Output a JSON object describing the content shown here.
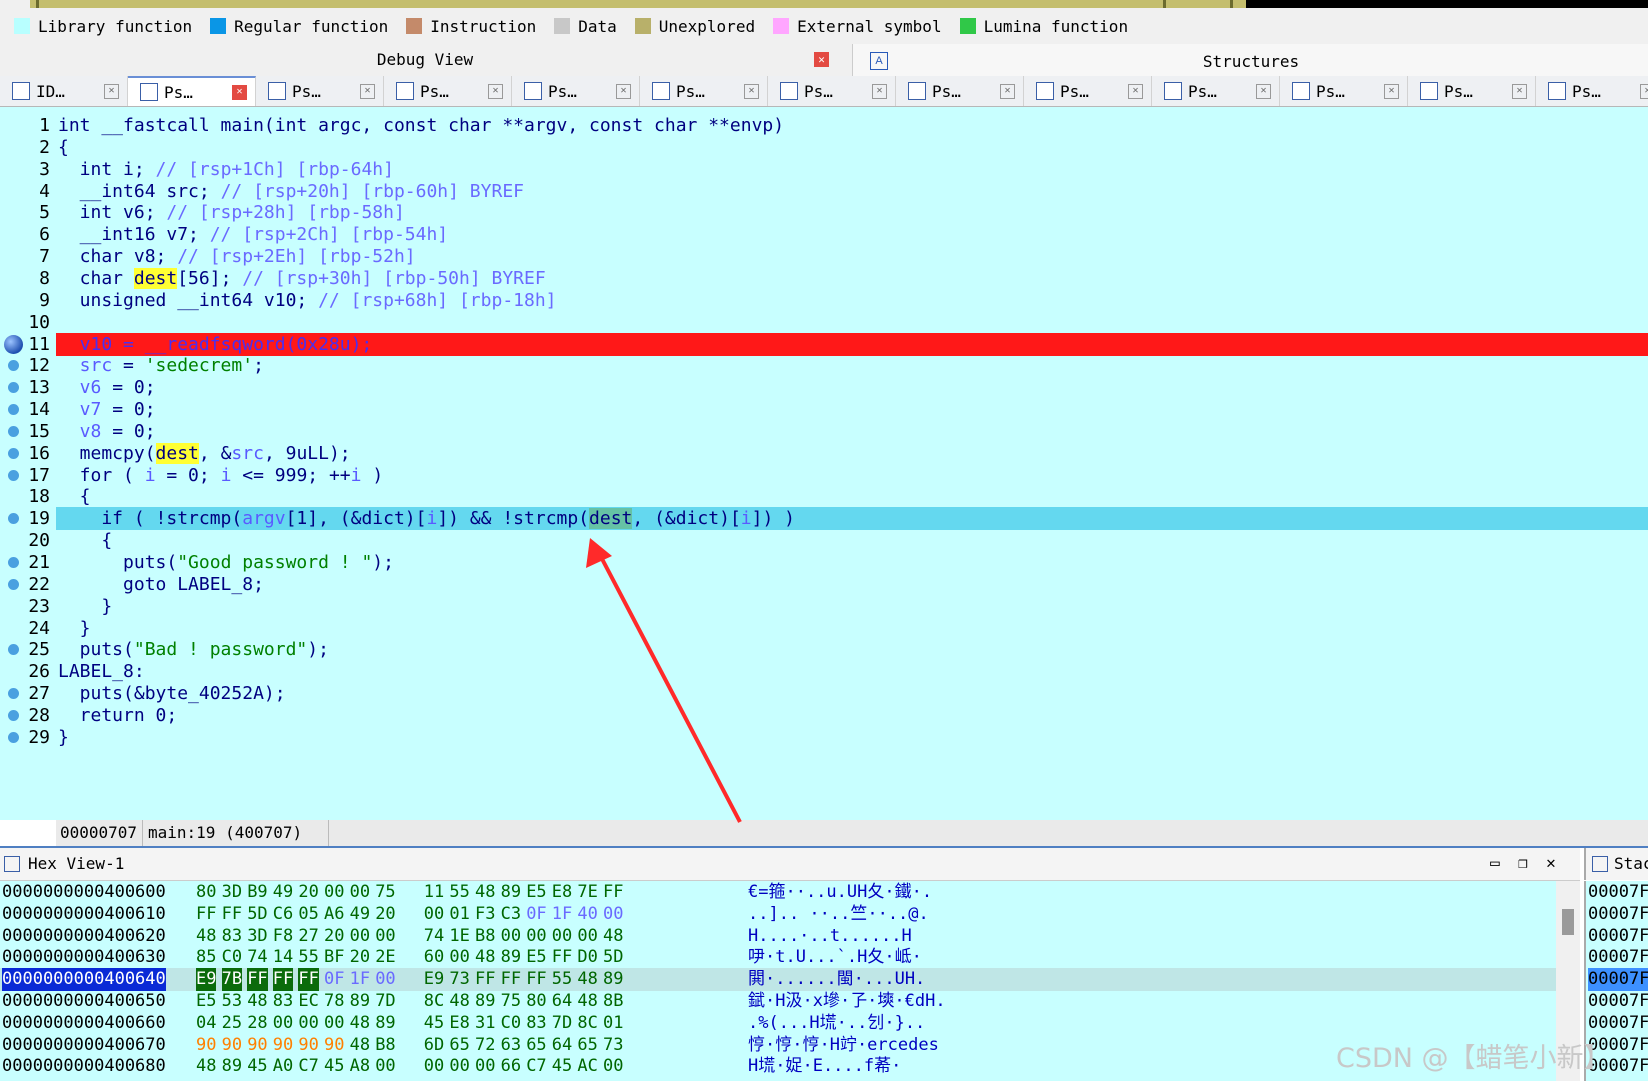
{
  "legend": [
    {
      "label": "Library function",
      "color": "#b8ffff"
    },
    {
      "label": "Regular function",
      "color": "#0a96e6"
    },
    {
      "label": "Instruction",
      "color": "#c48a6a"
    },
    {
      "label": "Data",
      "color": "#c8c8c8"
    },
    {
      "label": "Unexplored",
      "color": "#b8b06a"
    },
    {
      "label": "External symbol",
      "color": "#ffa6ff"
    },
    {
      "label": "Lumina function",
      "color": "#30c848"
    }
  ],
  "views": {
    "debug_title": "Debug View",
    "structures_title": "Structures"
  },
  "tabs": [
    {
      "label": "ID…",
      "active": false
    },
    {
      "label": "Ps…",
      "active": true
    },
    {
      "label": "Ps…",
      "active": false
    },
    {
      "label": "Ps…",
      "active": false
    },
    {
      "label": "Ps…",
      "active": false
    },
    {
      "label": "Ps…",
      "active": false
    },
    {
      "label": "Ps…",
      "active": false
    },
    {
      "label": "Ps…",
      "active": false
    },
    {
      "label": "Ps…",
      "active": false
    },
    {
      "label": "Ps…",
      "active": false
    },
    {
      "label": "Ps…",
      "active": false
    },
    {
      "label": "Ps…",
      "active": false
    },
    {
      "label": "Ps…",
      "active": false
    }
  ],
  "code_lines": [
    {
      "n": "1",
      "bp": "",
      "hl": "",
      "segs": [
        [
          "k",
          "int __fastcall main(int argc, const char **argv, const char **envp)"
        ]
      ]
    },
    {
      "n": "2",
      "bp": "",
      "hl": "",
      "segs": [
        [
          "k",
          "{"
        ]
      ]
    },
    {
      "n": "3",
      "bp": "",
      "hl": "",
      "segs": [
        [
          "k",
          "  int i; "
        ],
        [
          "c",
          "// [rsp+1Ch] [rbp-64h]"
        ]
      ]
    },
    {
      "n": "4",
      "bp": "",
      "hl": "",
      "segs": [
        [
          "k",
          "  __int64 src; "
        ],
        [
          "c",
          "// [rsp+20h] [rbp-60h] BYREF"
        ]
      ]
    },
    {
      "n": "5",
      "bp": "",
      "hl": "",
      "segs": [
        [
          "k",
          "  int v6; "
        ],
        [
          "c",
          "// [rsp+28h] [rbp-58h]"
        ]
      ]
    },
    {
      "n": "6",
      "bp": "",
      "hl": "",
      "segs": [
        [
          "k",
          "  __int16 v7; "
        ],
        [
          "c",
          "// [rsp+2Ch] [rbp-54h]"
        ]
      ]
    },
    {
      "n": "7",
      "bp": "",
      "hl": "",
      "segs": [
        [
          "k",
          "  char v8; "
        ],
        [
          "c",
          "// [rsp+2Eh] [rbp-52h]"
        ]
      ]
    },
    {
      "n": "8",
      "bp": "",
      "hl": "",
      "segs": [
        [
          "k",
          "  char "
        ],
        [
          "yl",
          "dest"
        ],
        [
          "k",
          "[56]; "
        ],
        [
          "c",
          "// [rsp+30h] [rbp-50h] BYREF"
        ]
      ]
    },
    {
      "n": "9",
      "bp": "",
      "hl": "",
      "segs": [
        [
          "k",
          "  unsigned __int64 v10; "
        ],
        [
          "c",
          "// [rsp+68h] [rbp-18h]"
        ]
      ]
    },
    {
      "n": "10",
      "bp": "",
      "hl": "",
      "segs": []
    },
    {
      "n": "11",
      "bp": "big",
      "hl": "red",
      "segs": [
        [
          "redtxt",
          "  v10 = __readfsqword(0x28u);"
        ]
      ]
    },
    {
      "n": "12",
      "bp": "dot",
      "hl": "",
      "segs": [
        [
          "v",
          "  src"
        ],
        [
          "k",
          " = "
        ],
        [
          "s",
          "'sedecrem'"
        ],
        [
          "k",
          ";"
        ]
      ]
    },
    {
      "n": "13",
      "bp": "dot",
      "hl": "",
      "segs": [
        [
          "v",
          "  v6"
        ],
        [
          "k",
          " = 0;"
        ]
      ]
    },
    {
      "n": "14",
      "bp": "dot",
      "hl": "",
      "segs": [
        [
          "v",
          "  v7"
        ],
        [
          "k",
          " = 0;"
        ]
      ]
    },
    {
      "n": "15",
      "bp": "dot",
      "hl": "",
      "segs": [
        [
          "v",
          "  v8"
        ],
        [
          "k",
          " = 0;"
        ]
      ]
    },
    {
      "n": "16",
      "bp": "dot",
      "hl": "",
      "segs": [
        [
          "k",
          "  memcpy("
        ],
        [
          "yl",
          "dest"
        ],
        [
          "k",
          ", &"
        ],
        [
          "v",
          "src"
        ],
        [
          "k",
          ", 9uLL);"
        ]
      ]
    },
    {
      "n": "17",
      "bp": "dot",
      "hl": "",
      "segs": [
        [
          "k",
          "  for ( "
        ],
        [
          "v",
          "i"
        ],
        [
          "k",
          " = 0; "
        ],
        [
          "v",
          "i"
        ],
        [
          "k",
          " <= 999; ++"
        ],
        [
          "v",
          "i"
        ],
        [
          "k",
          " )"
        ]
      ]
    },
    {
      "n": "18",
      "bp": "",
      "hl": "",
      "segs": [
        [
          "k",
          "  {"
        ]
      ]
    },
    {
      "n": "19",
      "bp": "dot",
      "hl": "blue",
      "segs": [
        [
          "k",
          "    if ( !strcmp("
        ],
        [
          "v",
          "argv"
        ],
        [
          "k",
          "[1], (&dict)["
        ],
        [
          "v",
          "i"
        ],
        [
          "k",
          "]) && !strcmp("
        ],
        [
          "gn",
          "dest"
        ],
        [
          "k",
          ", (&dict)["
        ],
        [
          "v",
          "i"
        ],
        [
          "k",
          "]) )"
        ]
      ]
    },
    {
      "n": "20",
      "bp": "",
      "hl": "",
      "segs": [
        [
          "k",
          "    {"
        ]
      ]
    },
    {
      "n": "21",
      "bp": "dot",
      "hl": "",
      "segs": [
        [
          "k",
          "      puts("
        ],
        [
          "s",
          "\"Good password ! \""
        ],
        [
          "k",
          ");"
        ]
      ]
    },
    {
      "n": "22",
      "bp": "dot",
      "hl": "",
      "segs": [
        [
          "k",
          "      goto LABEL_8;"
        ]
      ]
    },
    {
      "n": "23",
      "bp": "",
      "hl": "",
      "segs": [
        [
          "k",
          "    }"
        ]
      ]
    },
    {
      "n": "24",
      "bp": "",
      "hl": "",
      "segs": [
        [
          "k",
          "  }"
        ]
      ]
    },
    {
      "n": "25",
      "bp": "dot",
      "hl": "",
      "segs": [
        [
          "k",
          "  puts("
        ],
        [
          "s",
          "\"Bad ! password\""
        ],
        [
          "k",
          ");"
        ]
      ]
    },
    {
      "n": "26",
      "bp": "",
      "hl": "",
      "segs": [
        [
          "k",
          "LABEL_8:"
        ]
      ]
    },
    {
      "n": "27",
      "bp": "dot",
      "hl": "",
      "segs": [
        [
          "k",
          "  puts(&byte_40252A);"
        ]
      ]
    },
    {
      "n": "28",
      "bp": "dot",
      "hl": "",
      "segs": [
        [
          "k",
          "  return 0;"
        ]
      ]
    },
    {
      "n": "29",
      "bp": "dot",
      "hl": "",
      "segs": [
        [
          "k",
          "}"
        ]
      ]
    }
  ],
  "status": {
    "offset": "00000707",
    "location": "main:19 (400707)"
  },
  "hex_view": {
    "title": "Hex View-1",
    "rows": [
      {
        "addr": "0000000000400600",
        "bytes": [
          "80",
          "3D",
          "B9",
          "49",
          "20",
          "00",
          "00",
          "75",
          "11",
          "55",
          "48",
          "89",
          "E5",
          "E8",
          "7E",
          "FF"
        ],
        "ascii": "€=箍··..u.UH夂·鐵·.",
        "sel": false
      },
      {
        "addr": "0000000000400610",
        "bytes": [
          "FF",
          "FF",
          "5D",
          "C6",
          "05",
          "A6",
          "49",
          "20",
          "00",
          "01",
          "F3",
          "C3",
          "0F",
          "1F",
          "40",
          "00"
        ],
        "ascii": "..].. ··..竺··..@.",
        "sel": false
      },
      {
        "addr": "0000000000400620",
        "bytes": [
          "48",
          "83",
          "3D",
          "F8",
          "27",
          "20",
          "00",
          "00",
          "74",
          "1E",
          "B8",
          "00",
          "00",
          "00",
          "00",
          "48"
        ],
        "ascii": "H....·..t......H",
        "sel": false
      },
      {
        "addr": "0000000000400630",
        "bytes": [
          "85",
          "C0",
          "74",
          "14",
          "55",
          "BF",
          "20",
          "2E",
          "60",
          "00",
          "48",
          "89",
          "E5",
          "FF",
          "D0",
          "5D"
        ],
        "ascii": "吚·t.U...`.H夂·岻·",
        "sel": false
      },
      {
        "addr": "0000000000400640",
        "bytes": [
          "E9",
          "7B",
          "FF",
          "FF",
          "FF",
          "0F",
          "1F",
          "00",
          "E9",
          "73",
          "FF",
          "FF",
          "FF",
          "55",
          "48",
          "89"
        ],
        "ascii": "閧·......閩·...UH.",
        "sel": true
      },
      {
        "addr": "0000000000400650",
        "bytes": [
          "E5",
          "53",
          "48",
          "83",
          "EC",
          "78",
          "89",
          "7D",
          "8C",
          "48",
          "89",
          "75",
          "80",
          "64",
          "48",
          "8B"
        ],
        "ascii": "錻·H汲·x墋·孒·塽·€dH.",
        "sel": false
      },
      {
        "addr": "0000000000400660",
        "bytes": [
          "04",
          "25",
          "28",
          "00",
          "00",
          "00",
          "48",
          "89",
          "45",
          "E8",
          "31",
          "C0",
          "83",
          "7D",
          "8C",
          "01"
        ],
        "ascii": ".%(...H塃·..刉·}..",
        "sel": false
      },
      {
        "addr": "0000000000400670",
        "bytes": [
          "90",
          "90",
          "90",
          "90",
          "90",
          "90",
          "48",
          "B8",
          "6D",
          "65",
          "72",
          "63",
          "65",
          "64",
          "65",
          "73"
        ],
        "ascii": "悙·悙·悙·H竚·ercedes",
        "sel": false
      },
      {
        "addr": "0000000000400680",
        "bytes": [
          "48",
          "89",
          "45",
          "A0",
          "C7",
          "45",
          "A8",
          "00",
          "00",
          "00",
          "00",
          "66",
          "C7",
          "45",
          "AC",
          "00"
        ],
        "ascii": "H塃·娖·E....f莃·",
        "sel": false
      }
    ]
  },
  "stack_view": {
    "title": "Stac",
    "rows": [
      "00007F",
      "00007F",
      "00007F",
      "00007F",
      "00007F",
      "00007F",
      "00007F",
      "00007F",
      "00007F"
    ]
  },
  "watermark": "CSDN @【蜡笔小新】"
}
